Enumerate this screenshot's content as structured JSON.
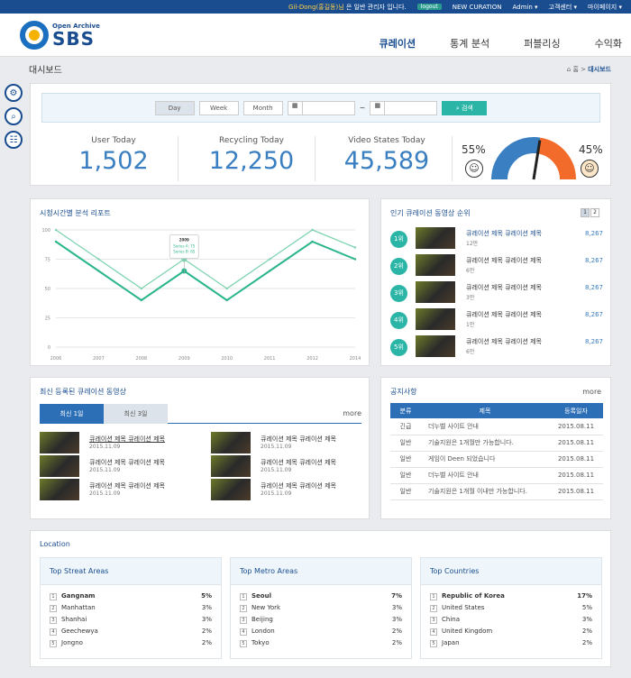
{
  "topbar": {
    "greeting_name": "Gil-Dong(홍길동)님",
    "greeting_rest": " 은 일반 관리자 입니다.",
    "logout": "logout",
    "links": [
      "NEW CURATION",
      "Admin ▾",
      "고객센터 ▾",
      "마이페이지 ▾"
    ]
  },
  "logo": {
    "sub": "Open Archive",
    "main": "SBS"
  },
  "nav": [
    "큐레이션",
    "통계 분석",
    "퍼블리싱",
    "수익화"
  ],
  "page": {
    "title": "대시보드",
    "path_home": "⌂ 홈 >",
    "path_current": "대시보드"
  },
  "filter": {
    "buttons": [
      "Day",
      "Week",
      "Month"
    ],
    "range_sep": "~",
    "search_label": "검색"
  },
  "stats": [
    {
      "label": "User Today",
      "value": "1,502"
    },
    {
      "label": "Recycling Today",
      "value": "12,250"
    },
    {
      "label": "Video States Today",
      "value": "45,589"
    }
  ],
  "gauge": {
    "left_pct": "55%",
    "right_pct": "45%",
    "value": 0.55,
    "color_left": "#3a7fc1",
    "color_right": "#f26b2a"
  },
  "chart_panel": {
    "title": "시청시간별 분석 리포트"
  },
  "chart_data": {
    "type": "line",
    "x": [
      "2006",
      "2007",
      "2008",
      "2009",
      "2010",
      "2011",
      "2012",
      "2014"
    ],
    "ylim": [
      0,
      100
    ],
    "yticks": [
      "0",
      "25",
      "50",
      "75",
      "100"
    ],
    "series": [
      {
        "name": "Series A",
        "values": [
          100,
          75,
          50,
          75,
          50,
          75,
          100,
          85
        ],
        "color": "#7ed3b0"
      },
      {
        "name": "Series B",
        "values": [
          90,
          65,
          40,
          65,
          40,
          65,
          90,
          75
        ],
        "color": "#2bb58c"
      }
    ],
    "tooltip": {
      "title": "2009",
      "line1": "Series A: 75",
      "line2": "Series B: 65"
    }
  },
  "popular": {
    "title": "인기 큐레이션 동영상 순위",
    "pages": [
      "1",
      "2"
    ],
    "items": [
      {
        "rank": "1위",
        "title": "큐레이션 제목 큐레이션 제목",
        "count": "12만",
        "value": "8,267"
      },
      {
        "rank": "2위",
        "title": "큐레이션 제목 큐레이션 제목",
        "count": "6만",
        "value": "8,267"
      },
      {
        "rank": "3위",
        "title": "큐레이션 제목 큐레이션 제목",
        "count": "3만",
        "value": "8,267"
      },
      {
        "rank": "4위",
        "title": "큐레이션 제목 큐레이션 제목",
        "count": "1만",
        "value": "8,267"
      },
      {
        "rank": "5위",
        "title": "큐레이션 제목 큐레이션 제목",
        "count": "6만",
        "value": "8,267"
      }
    ]
  },
  "recent": {
    "title": "최신 등록된 큐레이션 동영상",
    "tabs": [
      "최신 1일",
      "최신 3일"
    ],
    "more": "more",
    "items": [
      {
        "title": "큐레이션 제목 큐레이션 제목",
        "date": "2015.11.09"
      },
      {
        "title": "큐레이션 제목 큐레이션 제목",
        "date": "2015.11.09"
      },
      {
        "title": "큐레이션 제목 큐레이션 제목",
        "date": "2015.11.09"
      },
      {
        "title": "큐레이션 제목 큐레이션 제목",
        "date": "2015.11.09"
      },
      {
        "title": "큐레이션 제목 큐레이션 제목",
        "date": "2015.11.09"
      },
      {
        "title": "큐레이션 제목 큐레이션 제목",
        "date": "2015.11.09"
      }
    ]
  },
  "notice": {
    "title": "공지사항",
    "more": "more",
    "headers": [
      "분류",
      "제목",
      "등록일자"
    ],
    "rows": [
      {
        "cat": "긴급",
        "title": "더누벨 사이트 안내",
        "date": "2015.08.11"
      },
      {
        "cat": "일반",
        "title": "기술지원은 1개월만 가능합니다.",
        "date": "2015.08.11"
      },
      {
        "cat": "일반",
        "title": "게임이 Deen 되었습니다",
        "date": "2015.08.11"
      },
      {
        "cat": "일반",
        "title": "더누벨 사이트 안내",
        "date": "2015.08.11"
      },
      {
        "cat": "일반",
        "title": "기술지원은 1개월 이내만 가능합니다.",
        "date": "2015.08.11"
      }
    ]
  },
  "location": {
    "title": "Location",
    "columns": [
      {
        "title": "Top Streat Areas",
        "rows": [
          {
            "n": "1",
            "name": "Gangnam",
            "pct": "5%"
          },
          {
            "n": "2",
            "name": "Manhattan",
            "pct": "3%"
          },
          {
            "n": "3",
            "name": "Shanhai",
            "pct": "3%"
          },
          {
            "n": "4",
            "name": "Geechewya",
            "pct": "2%"
          },
          {
            "n": "5",
            "name": "Jongno",
            "pct": "2%"
          }
        ]
      },
      {
        "title": "Top Metro Areas",
        "rows": [
          {
            "n": "1",
            "name": "Seoul",
            "pct": "7%"
          },
          {
            "n": "2",
            "name": "New York",
            "pct": "3%"
          },
          {
            "n": "3",
            "name": "Beijing",
            "pct": "3%"
          },
          {
            "n": "4",
            "name": "London",
            "pct": "2%"
          },
          {
            "n": "5",
            "name": "Tokyo",
            "pct": "2%"
          }
        ]
      },
      {
        "title": "Top Countries",
        "rows": [
          {
            "n": "1",
            "name": "Republic of Korea",
            "pct": "17%"
          },
          {
            "n": "2",
            "name": "United States",
            "pct": "5%"
          },
          {
            "n": "3",
            "name": "China",
            "pct": "3%"
          },
          {
            "n": "4",
            "name": "United Kingdom",
            "pct": "2%"
          },
          {
            "n": "5",
            "name": "Japan",
            "pct": "2%"
          }
        ]
      }
    ]
  }
}
